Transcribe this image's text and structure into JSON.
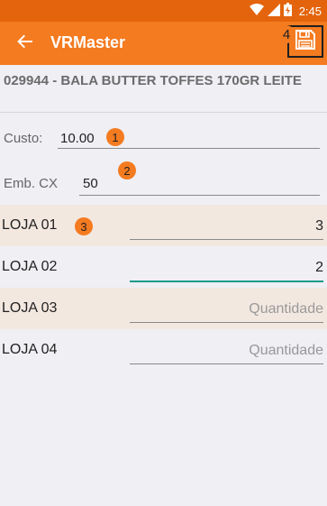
{
  "status_bar": {
    "time": "2:45"
  },
  "app_bar": {
    "title": "VRMaster",
    "save_badge": "4"
  },
  "product": {
    "name": "029944 - BALA BUTTER TOFFES 170GR LEITE"
  },
  "fields": {
    "custo": {
      "label": "Custo:",
      "value": "10.00",
      "badge": "1"
    },
    "emb": {
      "label": "Emb. CX",
      "value": "50",
      "badge": "2"
    }
  },
  "stores": [
    {
      "label": "LOJA 01",
      "value": "3",
      "placeholder": "Quantidade",
      "badge": "3"
    },
    {
      "label": "LOJA 02",
      "value": "2",
      "placeholder": "Quantidade"
    },
    {
      "label": "LOJA 03",
      "value": "",
      "placeholder": "Quantidade"
    },
    {
      "label": "LOJA 04",
      "value": "",
      "placeholder": "Quantidade"
    }
  ],
  "colors": {
    "primary": "#f47b20",
    "status": "#e3640c",
    "accent": "#1a9a8a",
    "row_alt": "#f3e8e0"
  }
}
